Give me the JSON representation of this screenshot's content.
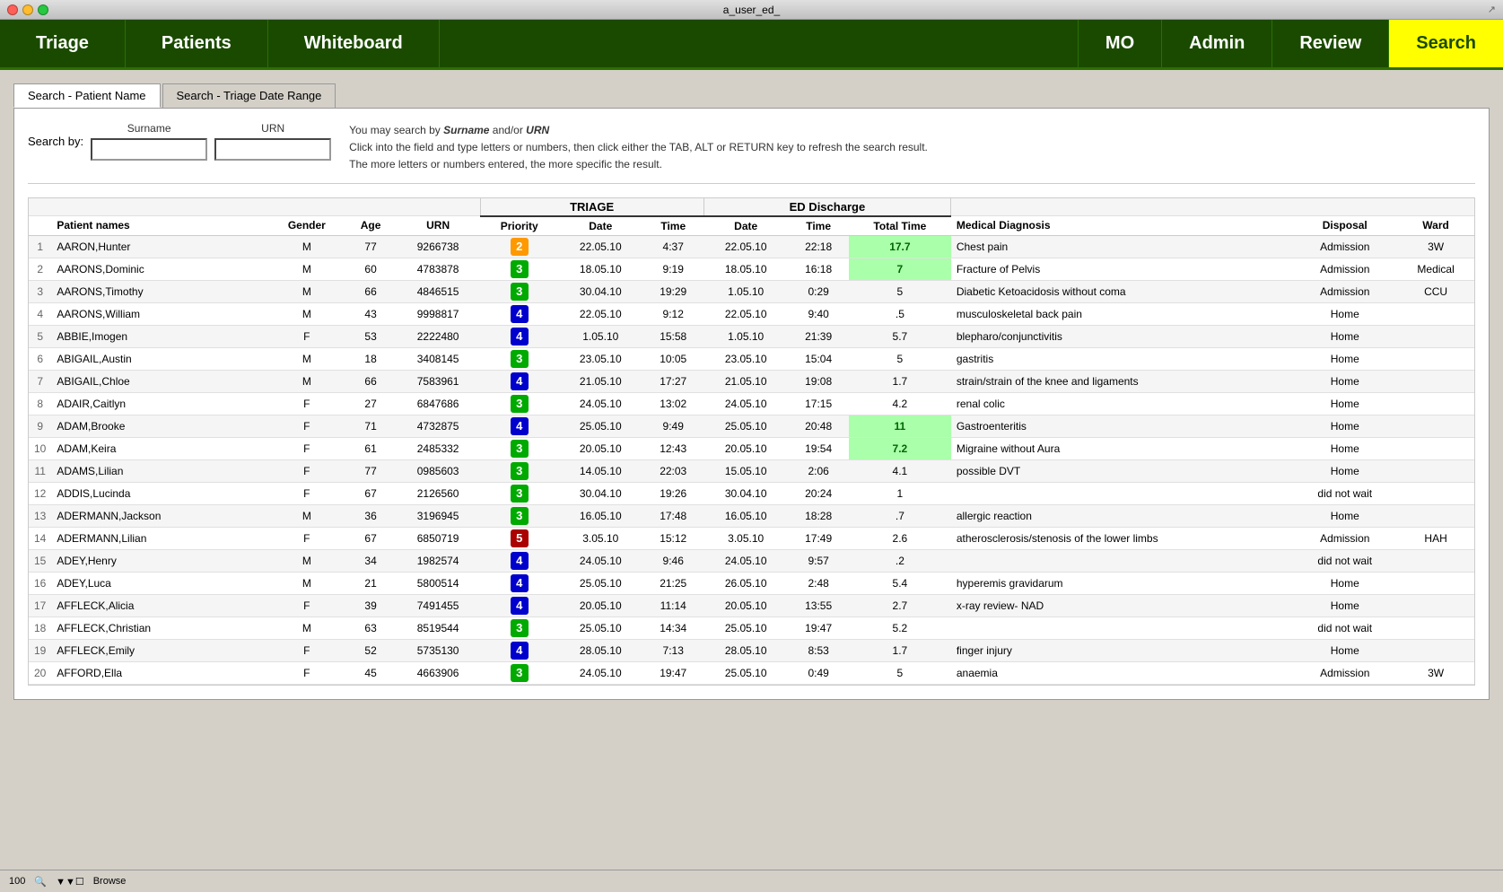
{
  "titlebar": {
    "title": "a_user_ed_"
  },
  "navbar": {
    "triage": "Triage",
    "patients": "Patients",
    "whiteboard": "Whiteboard",
    "mo": "MO",
    "admin": "Admin",
    "review": "Review",
    "search": "Search"
  },
  "tabs": [
    {
      "label": "Search - Patient Name",
      "active": true
    },
    {
      "label": "Search - Triage Date Range",
      "active": false
    }
  ],
  "search_form": {
    "search_by_label": "Search by:",
    "surname_label": "Surname",
    "urn_label": "URN",
    "hint_line1": "You may search by Surname and/or URN",
    "hint_line2": "Click into the field and type letters or numbers, then click either the TAB, ALT or RETURN key to refresh the search result.",
    "hint_line3": "The more letters or numbers entered, the more specific the result."
  },
  "table": {
    "section_triage": "TRIAGE",
    "section_ed": "ED Discharge",
    "col_row": "",
    "col_patient_names": "Patient names",
    "col_gender": "Gender",
    "col_age": "Age",
    "col_urn": "URN",
    "col_priority": "Priority",
    "col_triage_date": "Date",
    "col_triage_time": "Time",
    "col_ed_date": "Date",
    "col_ed_time": "Time",
    "col_total_time": "Total Time",
    "col_medical_diagnosis": "Medical Diagnosis",
    "col_disposal": "Disposal",
    "col_ward": "Ward",
    "rows": [
      {
        "row": 1,
        "name": "AARON,Hunter",
        "gender": "M",
        "age": 77,
        "urn": "9266738",
        "priority": 2,
        "t_date": "22.05.10",
        "t_time": "4:37",
        "e_date": "22.05.10",
        "e_time": "22:18",
        "total_time": "17.7",
        "diagnosis": "Chest pain",
        "disposal": "Admission",
        "ward": "3W",
        "highlight": true
      },
      {
        "row": 2,
        "name": "AARONS,Dominic",
        "gender": "M",
        "age": 60,
        "urn": "4783878",
        "priority": 3,
        "t_date": "18.05.10",
        "t_time": "9:19",
        "e_date": "18.05.10",
        "e_time": "16:18",
        "total_time": "7",
        "diagnosis": "Fracture of Pelvis",
        "disposal": "Admission",
        "ward": "Medical",
        "highlight": false
      },
      {
        "row": 3,
        "name": "AARONS,Timothy",
        "gender": "M",
        "age": 66,
        "urn": "4846515",
        "priority": 3,
        "t_date": "30.04.10",
        "t_time": "19:29",
        "e_date": "1.05.10",
        "e_time": "0:29",
        "total_time": "5",
        "diagnosis": "Diabetic Ketoacidosis without coma",
        "disposal": "Admission",
        "ward": "CCU",
        "highlight": false
      },
      {
        "row": 4,
        "name": "AARONS,William",
        "gender": "M",
        "age": 43,
        "urn": "9998817",
        "priority": 4,
        "t_date": "22.05.10",
        "t_time": "9:12",
        "e_date": "22.05.10",
        "e_time": "9:40",
        "total_time": ".5",
        "diagnosis": "musculoskeletal back pain",
        "disposal": "Home",
        "ward": "",
        "highlight": false
      },
      {
        "row": 5,
        "name": "ABBIE,Imogen",
        "gender": "F",
        "age": 53,
        "urn": "2222480",
        "priority": 4,
        "t_date": "1.05.10",
        "t_time": "15:58",
        "e_date": "1.05.10",
        "e_time": "21:39",
        "total_time": "5.7",
        "diagnosis": "blepharo/conjunctivitis",
        "disposal": "Home",
        "ward": "",
        "highlight": false
      },
      {
        "row": 6,
        "name": "ABIGAIL,Austin",
        "gender": "M",
        "age": 18,
        "urn": "3408145",
        "priority": 3,
        "t_date": "23.05.10",
        "t_time": "10:05",
        "e_date": "23.05.10",
        "e_time": "15:04",
        "total_time": "5",
        "diagnosis": "gastritis",
        "disposal": "Home",
        "ward": "",
        "highlight": false
      },
      {
        "row": 7,
        "name": "ABIGAIL,Chloe",
        "gender": "M",
        "age": 66,
        "urn": "7583961",
        "priority": 4,
        "t_date": "21.05.10",
        "t_time": "17:27",
        "e_date": "21.05.10",
        "e_time": "19:08",
        "total_time": "1.7",
        "diagnosis": "strain/strain of the knee and ligaments",
        "disposal": "Home",
        "ward": "",
        "highlight": false
      },
      {
        "row": 8,
        "name": "ADAIR,Caitlyn",
        "gender": "F",
        "age": 27,
        "urn": "6847686",
        "priority": 3,
        "t_date": "24.05.10",
        "t_time": "13:02",
        "e_date": "24.05.10",
        "e_time": "17:15",
        "total_time": "4.2",
        "diagnosis": "renal colic",
        "disposal": "Home",
        "ward": "",
        "highlight": false
      },
      {
        "row": 9,
        "name": "ADAM,Brooke",
        "gender": "F",
        "age": 71,
        "urn": "4732875",
        "priority": 4,
        "t_date": "25.05.10",
        "t_time": "9:49",
        "e_date": "25.05.10",
        "e_time": "20:48",
        "total_time": "11",
        "diagnosis": "Gastroenteritis",
        "disposal": "Home",
        "ward": "",
        "highlight": false
      },
      {
        "row": 10,
        "name": "ADAM,Keira",
        "gender": "F",
        "age": 61,
        "urn": "2485332",
        "priority": 3,
        "t_date": "20.05.10",
        "t_time": "12:43",
        "e_date": "20.05.10",
        "e_time": "19:54",
        "total_time": "7.2",
        "diagnosis": "Migraine without Aura",
        "disposal": "Home",
        "ward": "",
        "highlight": false
      },
      {
        "row": 11,
        "name": "ADAMS,Lilian",
        "gender": "F",
        "age": 77,
        "urn": "0985603",
        "priority": 3,
        "t_date": "14.05.10",
        "t_time": "22:03",
        "e_date": "15.05.10",
        "e_time": "2:06",
        "total_time": "4.1",
        "diagnosis": "possible DVT",
        "disposal": "Home",
        "ward": "",
        "highlight": false
      },
      {
        "row": 12,
        "name": "ADDIS,Lucinda",
        "gender": "F",
        "age": 67,
        "urn": "2126560",
        "priority": 3,
        "t_date": "30.04.10",
        "t_time": "19:26",
        "e_date": "30.04.10",
        "e_time": "20:24",
        "total_time": "1",
        "diagnosis": "",
        "disposal": "did not wait",
        "ward": "",
        "highlight": false
      },
      {
        "row": 13,
        "name": "ADERMANN,Jackson",
        "gender": "M",
        "age": 36,
        "urn": "3196945",
        "priority": 3,
        "t_date": "16.05.10",
        "t_time": "17:48",
        "e_date": "16.05.10",
        "e_time": "18:28",
        "total_time": ".7",
        "diagnosis": "allergic reaction",
        "disposal": "Home",
        "ward": "",
        "highlight": false
      },
      {
        "row": 14,
        "name": "ADERMANN,Lilian",
        "gender": "F",
        "age": 67,
        "urn": "6850719",
        "priority": 5,
        "t_date": "3.05.10",
        "t_time": "15:12",
        "e_date": "3.05.10",
        "e_time": "17:49",
        "total_time": "2.6",
        "diagnosis": "atherosclerosis/stenosis of the lower limbs",
        "disposal": "Admission",
        "ward": "HAH",
        "highlight": false
      },
      {
        "row": 15,
        "name": "ADEY,Henry",
        "gender": "M",
        "age": 34,
        "urn": "1982574",
        "priority": 4,
        "t_date": "24.05.10",
        "t_time": "9:46",
        "e_date": "24.05.10",
        "e_time": "9:57",
        "total_time": ".2",
        "diagnosis": "",
        "disposal": "did not wait",
        "ward": "",
        "highlight": false
      },
      {
        "row": 16,
        "name": "ADEY,Luca",
        "gender": "M",
        "age": 21,
        "urn": "5800514",
        "priority": 4,
        "t_date": "25.05.10",
        "t_time": "21:25",
        "e_date": "26.05.10",
        "e_time": "2:48",
        "total_time": "5.4",
        "diagnosis": "hyperemis gravidarum",
        "disposal": "Home",
        "ward": "",
        "highlight": false
      },
      {
        "row": 17,
        "name": "AFFLECK,Alicia",
        "gender": "F",
        "age": 39,
        "urn": "7491455",
        "priority": 4,
        "t_date": "20.05.10",
        "t_time": "11:14",
        "e_date": "20.05.10",
        "e_time": "13:55",
        "total_time": "2.7",
        "diagnosis": "x-ray review- NAD",
        "disposal": "Home",
        "ward": "",
        "highlight": false
      },
      {
        "row": 18,
        "name": "AFFLECK,Christian",
        "gender": "M",
        "age": 63,
        "urn": "8519544",
        "priority": 3,
        "t_date": "25.05.10",
        "t_time": "14:34",
        "e_date": "25.05.10",
        "e_time": "19:47",
        "total_time": "5.2",
        "diagnosis": "",
        "disposal": "did not wait",
        "ward": "",
        "highlight": false
      },
      {
        "row": 19,
        "name": "AFFLECK,Emily",
        "gender": "F",
        "age": 52,
        "urn": "5735130",
        "priority": 4,
        "t_date": "28.05.10",
        "t_time": "7:13",
        "e_date": "28.05.10",
        "e_time": "8:53",
        "total_time": "1.7",
        "diagnosis": "finger injury",
        "disposal": "Home",
        "ward": "",
        "highlight": false
      },
      {
        "row": 20,
        "name": "AFFORD,Ella",
        "gender": "F",
        "age": 45,
        "urn": "4663906",
        "priority": 3,
        "t_date": "24.05.10",
        "t_time": "19:47",
        "e_date": "25.05.10",
        "e_time": "0:49",
        "total_time": "5",
        "diagnosis": "anaemia",
        "disposal": "Admission",
        "ward": "3W",
        "highlight": false
      }
    ]
  },
  "statusbar": {
    "zoom": "100",
    "label": "Browse"
  }
}
